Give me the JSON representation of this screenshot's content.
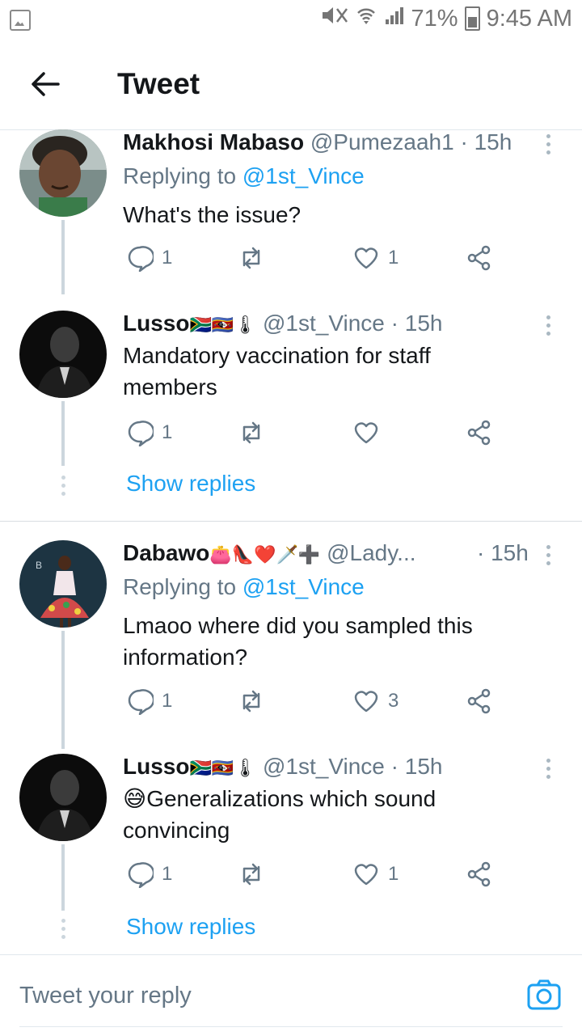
{
  "status_bar": {
    "battery": "71%",
    "time": "9:45 AM"
  },
  "header": {
    "title": "Tweet"
  },
  "tweets": [
    {
      "name": "Makhosi Mabaso",
      "handle": "@Pumezaah1",
      "time": "· 15h",
      "replying_label": "Replying to",
      "replying_to": "@1st_Vince",
      "text": "What's the issue?",
      "reply_count": "1",
      "retweet_count": "",
      "like_count": "1"
    },
    {
      "name": "Lusso",
      "name_emoji": "🇿🇦🇸🇿🌡",
      "handle": "@1st_Vince",
      "time": "· 15h",
      "text": "Mandatory vaccination for staff members",
      "reply_count": "1",
      "retweet_count": "",
      "like_count": "",
      "show_replies": "Show replies"
    },
    {
      "name": "Dabawo",
      "name_emoji": "👛👠❤️🗡️➕",
      "handle": "@Lady...",
      "time": "· 15h",
      "replying_label": "Replying to",
      "replying_to": "@1st_Vince",
      "text": "Lmaoo where did you sampled this information?",
      "reply_count": "1",
      "retweet_count": "",
      "like_count": "3"
    },
    {
      "name": "Lusso",
      "name_emoji": "🇿🇦🇸🇿🌡",
      "handle": "@1st_Vince",
      "time": "· 15h",
      "text_emoji": "😅",
      "text": "Generalizations which sound convincing",
      "reply_count": "1",
      "retweet_count": "",
      "like_count": "1",
      "show_replies": "Show replies"
    }
  ],
  "composer": {
    "placeholder": "Tweet your reply"
  },
  "colors": {
    "accent": "#1da1f2",
    "muted": "#657786",
    "thread_line": "#ccd6dd"
  }
}
